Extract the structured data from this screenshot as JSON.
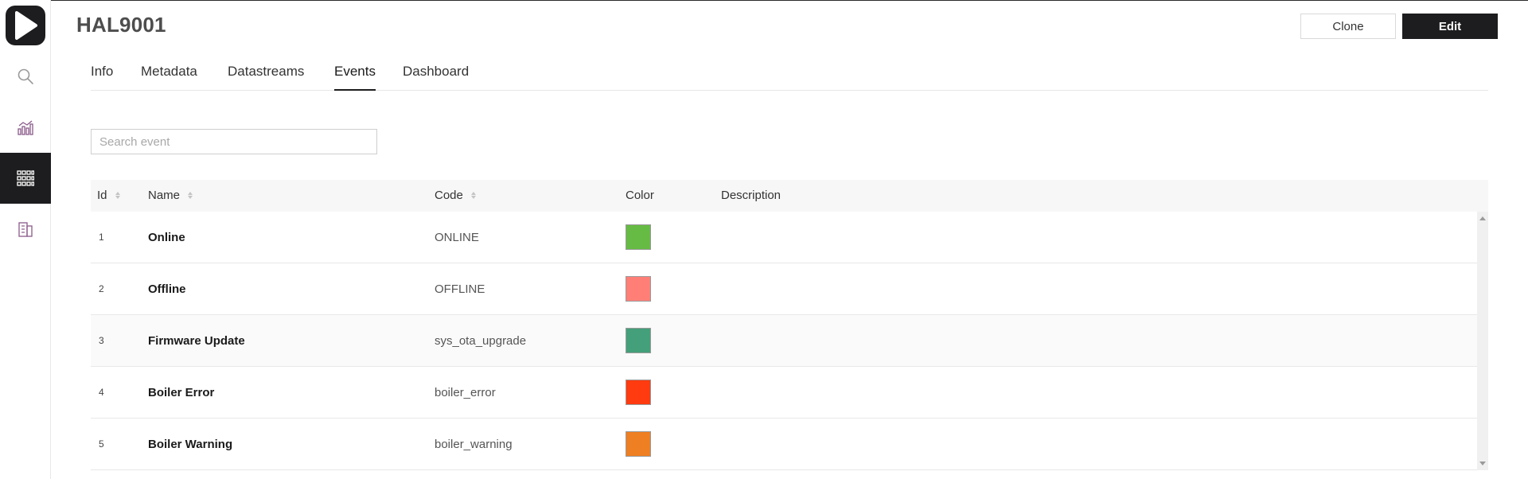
{
  "app": {
    "title": "HAL9001"
  },
  "sidebar": {
    "items": [
      {
        "icon": "search-icon",
        "active": false
      },
      {
        "icon": "analytics-chart-icon",
        "active": false
      },
      {
        "icon": "grid-apps-icon",
        "active": true
      },
      {
        "icon": "building-icon",
        "active": false
      }
    ]
  },
  "header": {
    "clone_label": "Clone",
    "edit_label": "Edit"
  },
  "tabs": [
    {
      "label": "Info",
      "active": false
    },
    {
      "label": "Metadata",
      "active": false
    },
    {
      "label": "Datastreams",
      "active": false
    },
    {
      "label": "Events",
      "active": true
    },
    {
      "label": "Dashboard",
      "active": false
    }
  ],
  "search": {
    "placeholder": "Search event",
    "value": ""
  },
  "table": {
    "columns": [
      "Id",
      "Name",
      "Code",
      "Color",
      "Description"
    ],
    "rows": [
      {
        "id": "1",
        "name": "Online",
        "code": "ONLINE",
        "color": "#66bb44",
        "description": ""
      },
      {
        "id": "2",
        "name": "Offline",
        "code": "OFFLINE",
        "color": "#ff7f77",
        "description": ""
      },
      {
        "id": "3",
        "name": "Firmware Update",
        "code": "sys_ota_upgrade",
        "color": "#44a07a",
        "description": ""
      },
      {
        "id": "4",
        "name": "Boiler Error",
        "code": "boiler_error",
        "color": "#ff3b0f",
        "description": ""
      },
      {
        "id": "5",
        "name": "Boiler Warning",
        "code": "boiler_warning",
        "color": "#ee7f22",
        "description": ""
      }
    ]
  },
  "colors": {
    "accent": "#1d1d1f",
    "title_text": "#4d4d4d",
    "header_bg": "#f7f7f7"
  }
}
